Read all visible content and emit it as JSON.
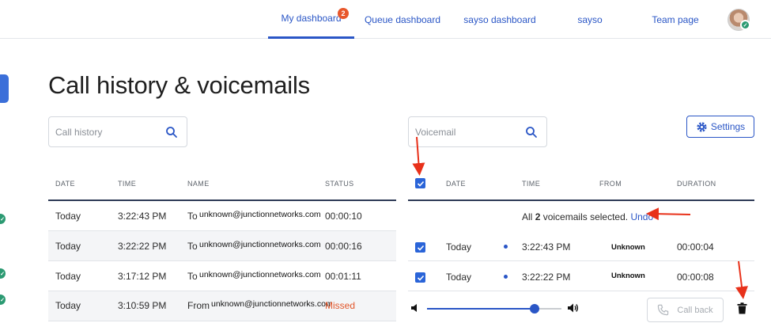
{
  "nav": {
    "tabs": [
      {
        "label": "My dashboard",
        "badge": "2",
        "active": true
      },
      {
        "label": "Queue dashboard"
      },
      {
        "label": "sayso dashboard"
      },
      {
        "label": "sayso"
      },
      {
        "label": "Team page"
      }
    ],
    "avatar_icon": "user-avatar",
    "status_icon": "check-icon"
  },
  "page": {
    "title": "Call history & voicemails"
  },
  "call_history": {
    "search_placeholder": "Call history",
    "columns": [
      "DATE",
      "TIME",
      "NAME",
      "STATUS"
    ],
    "rows": [
      {
        "date": "Today",
        "time": "3:22:43 PM",
        "direction": "To",
        "name": "unknown@junctionnetworks.com",
        "status": "00:00:10"
      },
      {
        "date": "Today",
        "time": "3:22:22 PM",
        "direction": "To",
        "name": "unknown@junctionnetworks.com",
        "status": "00:00:16"
      },
      {
        "date": "Today",
        "time": "3:17:12 PM",
        "direction": "To",
        "name": "unknown@junctionnetworks.com",
        "status": "00:01:11"
      },
      {
        "date": "Today",
        "time": "3:10:59 PM",
        "direction": "From",
        "name": "unknown@junctionnetworks.com",
        "status": "Missed"
      }
    ]
  },
  "voicemail": {
    "search_placeholder": "Voicemail",
    "settings_label": "Settings",
    "columns": [
      "DATE",
      "TIME",
      "FROM",
      "DURATION"
    ],
    "selection": {
      "prefix": "All",
      "count": "2",
      "suffix": "voicemails selected.",
      "undo": "Undo"
    },
    "rows": [
      {
        "date": "Today",
        "time": "3:22:43 PM",
        "from": "Unknown",
        "duration": "00:00:04"
      },
      {
        "date": "Today",
        "time": "3:22:22 PM",
        "from": "Unknown",
        "duration": "00:00:08"
      }
    ],
    "player": {
      "volume": 0.8
    },
    "callback_label": "Call back"
  },
  "colors": {
    "accent": "#2a56c6",
    "missed": "#e2562a",
    "annotation": "#e8311a",
    "success": "#2b9a72"
  }
}
